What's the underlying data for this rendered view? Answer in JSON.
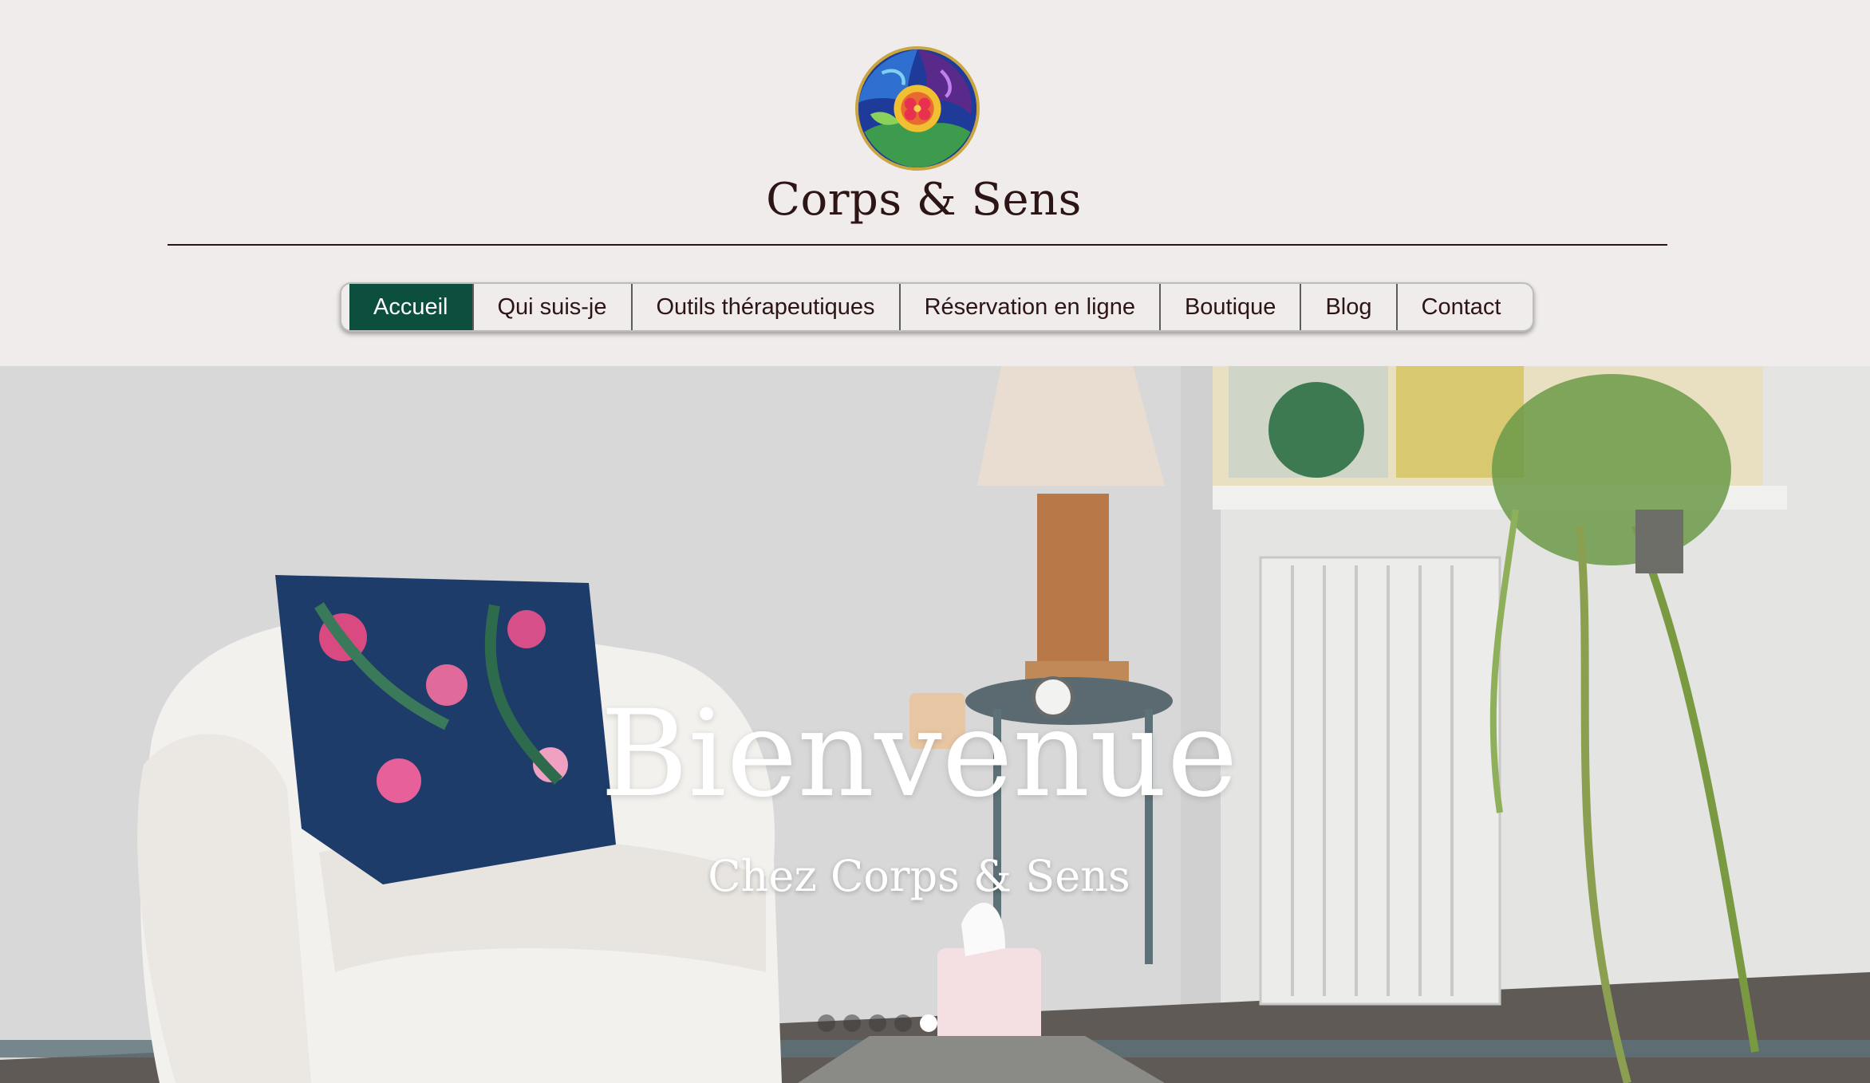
{
  "site": {
    "title": "Corps & Sens"
  },
  "logo": {
    "icon": "mandala-logo-icon"
  },
  "nav": {
    "items": [
      {
        "label": "Accueil",
        "active": true
      },
      {
        "label": "Qui suis-je",
        "active": false
      },
      {
        "label": "Outils thérapeutiques",
        "active": false
      },
      {
        "label": "Réservation en ligne",
        "active": false
      },
      {
        "label": "Boutique",
        "active": false
      },
      {
        "label": "Blog",
        "active": false
      },
      {
        "label": "Contact",
        "active": false
      }
    ]
  },
  "hero": {
    "title": "Bienvenue",
    "subtitle": "Chez Corps & Sens",
    "slides_count": 5,
    "active_slide": 5
  },
  "colors": {
    "background": "#efeceb",
    "accent": "#0d4f3f",
    "text": "#2d1415"
  }
}
